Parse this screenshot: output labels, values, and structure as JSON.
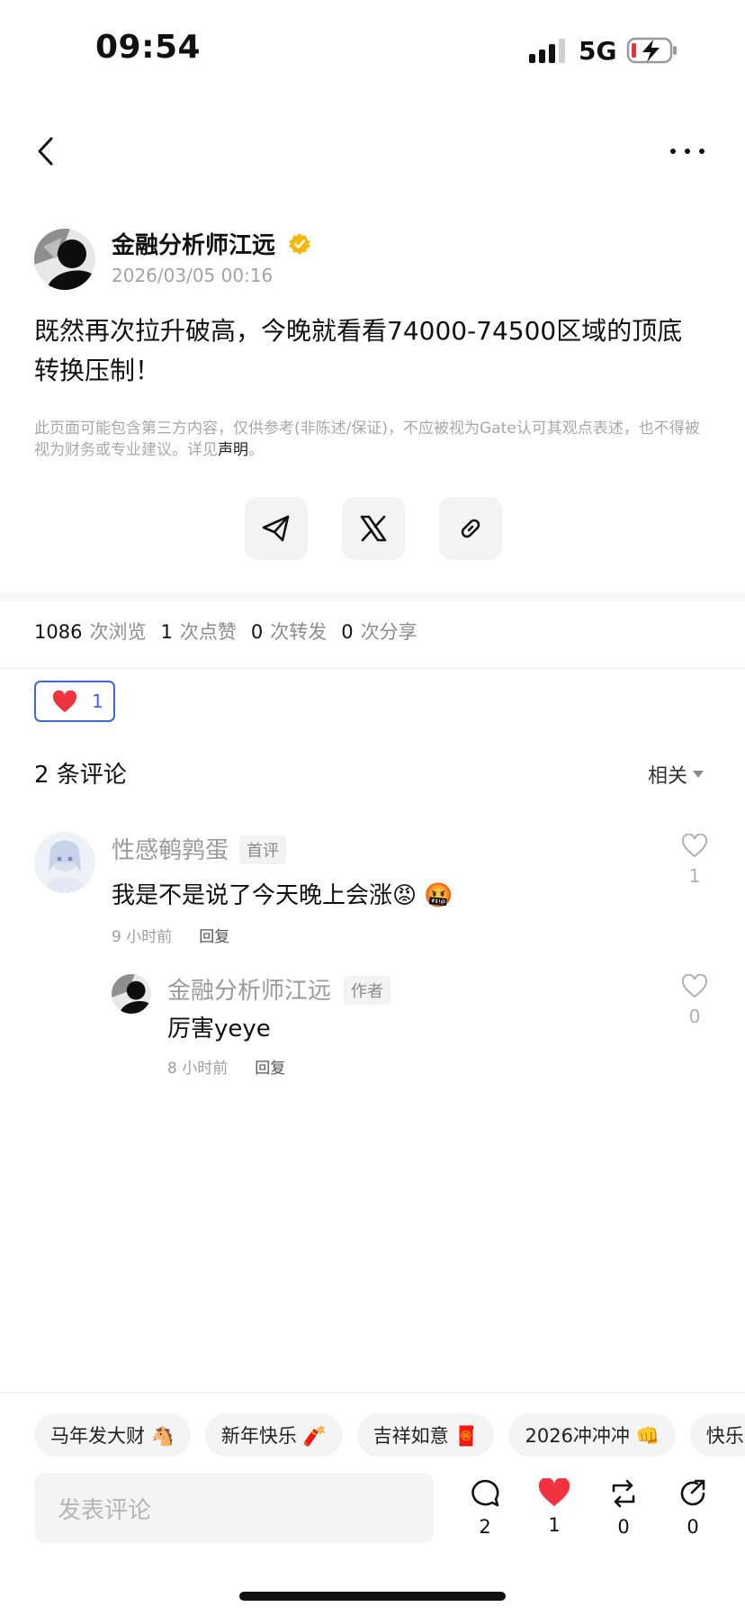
{
  "status_bar": {
    "time": "09:54",
    "network": "5G"
  },
  "post": {
    "author": "金融分析师江远",
    "timestamp": "2026/03/05 00:16",
    "text_line1": "既然再次拉升破高，今晚就看看74000-74500区域的顶底",
    "text_line2": "转换压制！",
    "disclaimer": "此页面可能包含第三方内容，仅供参考(非陈述/保证)，不应被视为Gate认可其观点表述，也不得被视为财务或专业建议。详见",
    "disclaimer_link": "声明",
    "disclaimer_end": "。"
  },
  "share": {
    "telegram_icon": "telegram-icon",
    "x_icon": "x-icon",
    "link_icon": "link-icon"
  },
  "stats": {
    "views": "1086",
    "views_label": "次浏览",
    "likes": "1",
    "likes_label": "次点赞",
    "reposts": "0",
    "reposts_label": "次转发",
    "shares": "0",
    "shares_label": "次分享"
  },
  "reaction": {
    "emoji": "heart",
    "count": "1"
  },
  "comments": {
    "title": "2 条评论",
    "sort_label": "相关",
    "items": [
      {
        "name": "性感鹌鹑蛋",
        "badge": "首评",
        "text": "我是不是说了今天晚上会涨😡 🤬",
        "time": "9 小时前",
        "reply": "回复",
        "likes": "1"
      },
      {
        "name": "金融分析师江远",
        "badge": "作者",
        "text": "厉害yeye",
        "time": "8 小时前",
        "reply": "回复",
        "likes": "0"
      }
    ]
  },
  "tags": [
    "马年发大财 🐴",
    "新年快乐 🧨",
    "吉祥如意 🧧",
    "2026冲冲冲 👊",
    "快乐"
  ],
  "composer": {
    "placeholder": "发表评论",
    "comment_count": "2",
    "like_count": "1",
    "repost_count": "0",
    "share_count": "0"
  },
  "colors": {
    "accent": "#3e67d6",
    "like_red": "#f0333f",
    "verified_gold": "#f0b90b"
  }
}
